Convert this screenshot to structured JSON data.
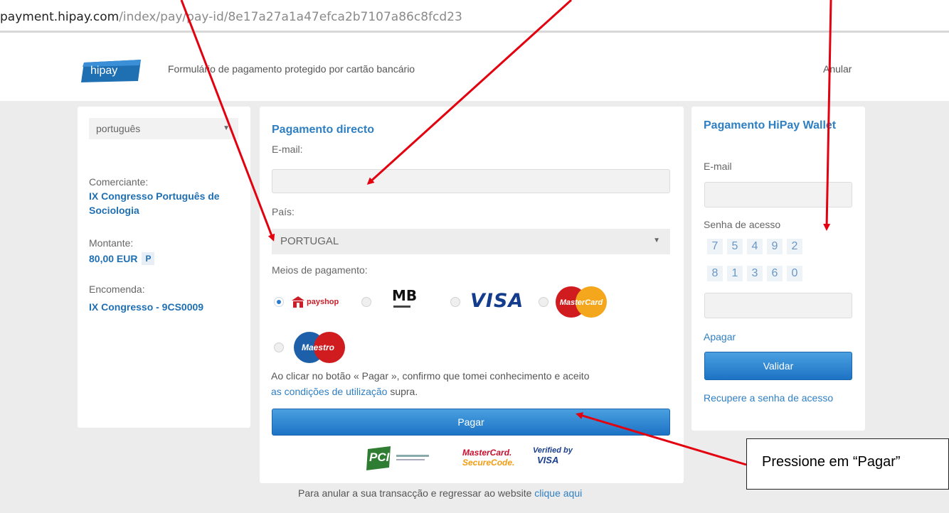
{
  "browser": {
    "url_host": "payment.hipay.com",
    "url_path": "/index/pay/pay-id/8e17a27a1a47efca2b7107a86c8fcd23"
  },
  "header": {
    "logo_text": "hipay",
    "title": "Formulário de pagamento protegido por cartão bancário",
    "cancel_label": "Anular"
  },
  "sidebar": {
    "language": "português",
    "merchant_label": "Comerciante:",
    "merchant_value": "IX Congresso Português de Sociologia",
    "amount_label": "Montante:",
    "amount_value": "80,00 EUR",
    "amount_badge": "P",
    "order_label": "Encomenda:",
    "order_value": "IX Congresso - 9CS0009"
  },
  "direct_payment": {
    "title": "Pagamento directo",
    "email_label": "E-mail:",
    "email_value": "",
    "country_label": "País:",
    "country_value": "PORTUGAL",
    "methods_label": "Meios de pagamento:",
    "methods": [
      {
        "name": "payshop",
        "label": "payshop",
        "selected": true
      },
      {
        "name": "multibanco",
        "label": "MB",
        "selected": false
      },
      {
        "name": "visa",
        "label": "VISA",
        "selected": false
      },
      {
        "name": "mastercard",
        "label": "MasterCard",
        "selected": false
      },
      {
        "name": "maestro",
        "label": "Maestro",
        "selected": false
      }
    ],
    "legal_text_before": "Ao clicar no botão « Pagar », confirmo que tomei conhecimento e aceito",
    "legal_link": "as condições de utilização",
    "legal_text_after": " supra.",
    "pay_button": "Pagar",
    "trust_pci": "PCI",
    "trust_mastercard_line1": "MasterCard.",
    "trust_mastercard_line2": "SecureCode.",
    "trust_visa_line1": "Verified by",
    "trust_visa_line2": "VISA"
  },
  "wallet": {
    "title": "Pagamento HiPay Wallet",
    "email_label": "E-mail",
    "password_label": "Senha de acesso",
    "pin_row1": [
      "7",
      "5",
      "4",
      "9",
      "2"
    ],
    "pin_row2": [
      "8",
      "1",
      "3",
      "6",
      "0"
    ],
    "clear_label": "Apagar",
    "validate_button": "Validar",
    "recover_link": "Recupere a senha de acesso"
  },
  "footer": {
    "text": "Para anular a sua transacção e regressar ao website ",
    "link": "clique aqui"
  },
  "annotation": {
    "text": "Pressione em “Pagar”"
  },
  "colors": {
    "accent": "#2f7fc3",
    "button": "#1d73c4",
    "arrow": "#e3000f",
    "background": "#ececec"
  }
}
